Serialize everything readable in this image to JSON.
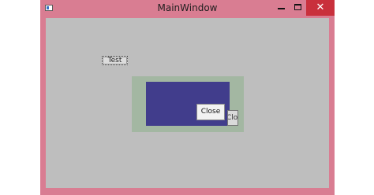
{
  "window": {
    "title": "MainWindow",
    "controls": {
      "minimize_icon": "minimize-icon",
      "maximize_icon": "maximize-icon",
      "close_glyph": "✕"
    }
  },
  "content": {
    "test_button_label": "Test",
    "close_button_label": "Close",
    "partial_button_label": "Close"
  },
  "colors": {
    "frame": "#d97d92",
    "client_bg": "#bebebe",
    "green_panel": "#a3b7a2",
    "blue_panel": "#413d8c",
    "close_hover": "#c9303c"
  }
}
